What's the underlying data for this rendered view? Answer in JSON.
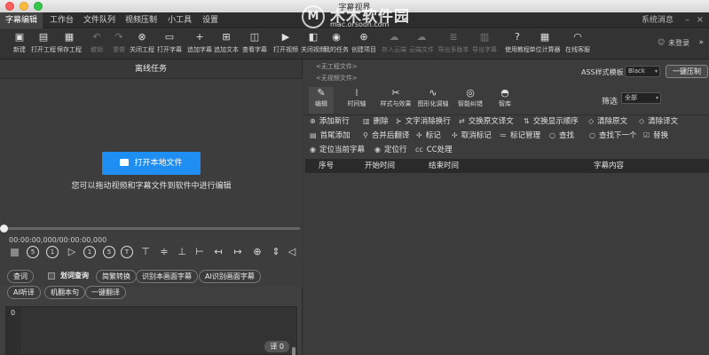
{
  "window": {
    "title": "字幕视界"
  },
  "watermark": {
    "logo": "M",
    "title": "木木软件园",
    "url": "mac.orsoon.com"
  },
  "menu": {
    "items": [
      "字幕编辑",
      "工作台",
      "文件队列",
      "视频压制",
      "小工具",
      "设置"
    ],
    "active_index": 0,
    "system_messages": "系统消息",
    "minimize": "–",
    "close": "×"
  },
  "toolbar": {
    "buttons": [
      {
        "label": "新建",
        "icon": "new-file-icon",
        "glyph": "▣",
        "enabled": true
      },
      {
        "label": "打开工程",
        "icon": "folder-open-icon",
        "glyph": "▤",
        "enabled": true
      },
      {
        "label": "保存工程",
        "icon": "save-icon",
        "glyph": "▦",
        "enabled": true
      },
      {
        "label": "撤销",
        "icon": "undo-icon",
        "glyph": "↶",
        "enabled": false
      },
      {
        "label": "重做",
        "icon": "redo-icon",
        "glyph": "↷",
        "enabled": false
      },
      {
        "label": "关闭工程",
        "icon": "close-circle-icon",
        "glyph": "⊗",
        "enabled": true
      },
      {
        "label": "打开字幕",
        "icon": "folder-icon",
        "glyph": "▭",
        "enabled": true
      },
      {
        "label": "追加字幕",
        "icon": "plus-icon",
        "glyph": "+",
        "enabled": true
      },
      {
        "label": "追加文本",
        "icon": "text-box-icon",
        "glyph": "⊞",
        "enabled": true
      },
      {
        "label": "查看字幕",
        "icon": "view-subtitle-icon",
        "glyph": "◫",
        "enabled": true
      },
      {
        "label": "打开视频",
        "icon": "video-camera-icon",
        "glyph": "▶",
        "enabled": true
      },
      {
        "label": "关闭视频",
        "icon": "video-off-icon",
        "glyph": "◧",
        "enabled": true
      },
      {
        "label": "我的任务",
        "icon": "task-icon",
        "glyph": "◉",
        "enabled": true
      },
      {
        "label": "创建项目",
        "icon": "create-project-icon",
        "glyph": "⊕",
        "enabled": true
      },
      {
        "label": "存入云端",
        "icon": "cloud-upload-icon",
        "glyph": "☁",
        "enabled": false
      },
      {
        "label": "云端文件",
        "icon": "cloud-file-icon",
        "glyph": "☁",
        "enabled": false
      },
      {
        "label": "导出多版本",
        "icon": "export-multi-icon",
        "glyph": "≣",
        "enabled": false
      },
      {
        "label": "导出字幕",
        "icon": "export-subtitle-icon",
        "glyph": "▥",
        "enabled": false
      },
      {
        "label": "使用教程",
        "icon": "help-icon",
        "glyph": "?",
        "enabled": true
      },
      {
        "label": "单位计算器",
        "icon": "calculator-icon",
        "glyph": "▦",
        "enabled": true
      },
      {
        "label": "在线客服",
        "icon": "headset-icon",
        "glyph": "◠",
        "enabled": true
      }
    ],
    "login": "未登录",
    "more": "»"
  },
  "left": {
    "header": "离线任务",
    "open_button": "打开本地文件",
    "hint": "您可以拖动视频和字幕文件到软件中进行编辑",
    "progress": 0,
    "timecode": "00:00:00,000/00:00:00,000",
    "controls": [
      {
        "icon": "stop-icon",
        "glyph": ""
      },
      {
        "icon": "rewind-5-icon",
        "glyph": "5"
      },
      {
        "icon": "rewind-1-icon",
        "glyph": "1"
      },
      {
        "icon": "play-icon",
        "glyph": "▷"
      },
      {
        "icon": "forward-1-icon",
        "glyph": "1"
      },
      {
        "icon": "forward-5-icon",
        "glyph": "5"
      },
      {
        "icon": "text-t-icon",
        "glyph": "T"
      },
      {
        "icon": "align-top-icon",
        "glyph": "⊤"
      },
      {
        "icon": "align-middle-icon",
        "glyph": "≑"
      },
      {
        "icon": "align-bottom-icon",
        "glyph": "⊥"
      },
      {
        "icon": "align-left-icon",
        "glyph": "⊢"
      },
      {
        "icon": "move-left-icon",
        "glyph": "↤"
      },
      {
        "icon": "move-right-icon",
        "glyph": "↦"
      },
      {
        "icon": "crosshair-icon",
        "glyph": "⊕"
      },
      {
        "icon": "vertical-split-icon",
        "glyph": "⇕"
      },
      {
        "icon": "volume-icon",
        "glyph": "◁"
      }
    ],
    "row1": [
      "查词",
      "划词查询",
      "简繁转换",
      "识别本画面字幕",
      "AI识别画面字幕"
    ],
    "row2": [
      "AI听译",
      "机翻本句",
      "一键翻译"
    ],
    "editor": {
      "line_number": "0",
      "char_count": "译 0"
    }
  },
  "right": {
    "project_lines": [
      "<无工程文件>",
      "<无视频文件>"
    ],
    "ass_label": "ASS样式模板",
    "ass_value": "Black",
    "compress_button": "一键压制",
    "tabs": [
      {
        "label": "编辑",
        "icon": "pencil-icon",
        "glyph": "✎"
      },
      {
        "label": "时间轴",
        "icon": "timeline-icon",
        "glyph": "⁞"
      },
      {
        "label": "样式与效果",
        "icon": "style-effects-icon",
        "glyph": "✂"
      },
      {
        "label": "图形化调轴",
        "icon": "graph-timeline-icon",
        "glyph": "∿"
      },
      {
        "label": "智能纠错",
        "icon": "smart-correct-icon",
        "glyph": "◎"
      },
      {
        "label": "智库",
        "icon": "knowledge-icon",
        "glyph": "◓"
      }
    ],
    "active_tab": 0,
    "filter_label": "筛选",
    "filter_value": "全部",
    "actions_row1": [
      {
        "label": "添加新行",
        "icon": "add-row-icon",
        "glyph": "⊕"
      },
      {
        "label": "删除",
        "icon": "delete-icon",
        "glyph": "▥"
      },
      {
        "label": "文字消除换行",
        "icon": "remove-linebreak-icon",
        "glyph": "⊱"
      },
      {
        "label": "交换原文译文",
        "icon": "swap-text-icon",
        "glyph": "⇄"
      },
      {
        "label": "交换显示顺序",
        "icon": "swap-order-icon",
        "glyph": "⇅"
      },
      {
        "label": "清除原文",
        "icon": "clear-source-icon",
        "glyph": "◇"
      },
      {
        "label": "清除译文",
        "icon": "clear-translation-icon",
        "glyph": "◇"
      }
    ],
    "actions_row2": [
      {
        "label": "首尾添加",
        "icon": "add-ends-icon",
        "glyph": "▤"
      },
      {
        "label": "合并后翻译",
        "icon": "merge-translate-icon",
        "glyph": "⚲"
      },
      {
        "label": "标记",
        "icon": "pin-icon",
        "glyph": "✢"
      },
      {
        "label": "取消标记",
        "icon": "unpin-icon",
        "glyph": "✢"
      },
      {
        "label": "标记管理",
        "icon": "mark-manage-icon",
        "glyph": "≔"
      },
      {
        "label": "查找",
        "icon": "search-icon",
        "glyph": "○"
      },
      {
        "label": "查找下一个",
        "icon": "find-next-icon",
        "glyph": "○"
      },
      {
        "label": "替换",
        "icon": "replace-icon",
        "glyph": "☑"
      }
    ],
    "actions_row3": [
      {
        "label": "定位当前字幕",
        "icon": "locate-current-icon",
        "glyph": "◉"
      },
      {
        "label": "定位行",
        "icon": "locate-line-icon",
        "glyph": "◉"
      },
      {
        "label": "CC处理",
        "icon": "cc-icon",
        "glyph": "cc"
      }
    ],
    "columns": [
      "序号",
      "开始时间",
      "结束时间",
      "字幕内容"
    ]
  }
}
